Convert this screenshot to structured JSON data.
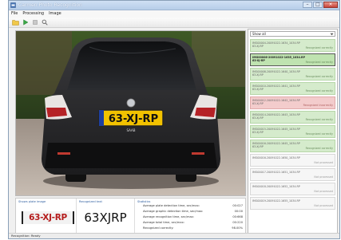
{
  "window": {
    "title": "Carmen Photo Recognition"
  },
  "menu": [
    "File",
    "Processing",
    "Image"
  ],
  "toolbar": {
    "icons": [
      "open-folder-icon",
      "play-icon",
      "stop-icon",
      "search-icon"
    ]
  },
  "photo": {
    "plate_text": "63-XJ-RP",
    "badge_text": "SAAB"
  },
  "plate_panel": {
    "label": "Shows plate image",
    "plate_text": "63-XJ-RP"
  },
  "text_panel": {
    "label": "Recognized text",
    "value": "63XJRP"
  },
  "stats_panel": {
    "label": "Statistics",
    "rows": [
      {
        "label": "Average plate detection time, sec/max:",
        "value": "00:027"
      },
      {
        "label": "Average graphic detection time, sec/max:",
        "value": "00:00"
      },
      {
        "label": "Average recognition time, sec/max:",
        "value": "00:668"
      },
      {
        "label": "Average total time, sec/max:",
        "value": "00:220"
      },
      {
        "label": "Recognized correctly:",
        "value": "98.00%"
      }
    ]
  },
  "sidebar": {
    "filter": "Show all",
    "items": [
      {
        "name": "IMG00004-20091022-1634_1034.RP",
        "plate": "63-XJ-RP",
        "status": "Recognized correctly",
        "state": "correct"
      },
      {
        "name": "IMG00006-20091022-1635_1034.RP",
        "plate": "63-XJ-RP",
        "status": "Recognized correctly",
        "state": "selected"
      },
      {
        "name": "IMG00008-20091022-1640_1034.RP",
        "plate": "63-XJ-RP",
        "status": "Recognized correctly",
        "state": "correct"
      },
      {
        "name": "IMG00010-20091022-1641_1034.RP",
        "plate": "63-XJ-RP",
        "status": "Recognized correctly",
        "state": "correct"
      },
      {
        "name": "IMG00012-20091022-1642_1034.RP",
        "plate": "63-XJ-RP",
        "status": "Recognized incorrectly",
        "state": "incorrect"
      },
      {
        "name": "IMG00014-20091022-1643_1034.RP",
        "plate": "63-XJ-RP",
        "status": "Recognized correctly",
        "state": "correct"
      },
      {
        "name": "IMG00015-20091022-1645_1034.RP",
        "plate": "63-XJ-RP",
        "status": "Recognized correctly",
        "state": "correct"
      },
      {
        "name": "IMG00016-20091022-1645_1034.RP",
        "plate": "63-XJ-RP",
        "status": "Recognized correctly",
        "state": "correct"
      },
      {
        "name": "IMG00016-20091022-1650_1034.RP",
        "plate": "",
        "status": "Not processed",
        "state": "notproc"
      },
      {
        "name": "IMG00017-20091022-1651_1034.RP",
        "plate": "",
        "status": "Not processed",
        "state": "notproc"
      },
      {
        "name": "IMG00018-20091022-1652_1034.RP",
        "plate": "",
        "status": "Not processed",
        "state": "notproc"
      },
      {
        "name": "IMG00019-20091022-1655_1034.RP",
        "plate": "",
        "status": "Not processed",
        "state": "notproc"
      }
    ]
  },
  "status_bar": "Recognition: Ready"
}
